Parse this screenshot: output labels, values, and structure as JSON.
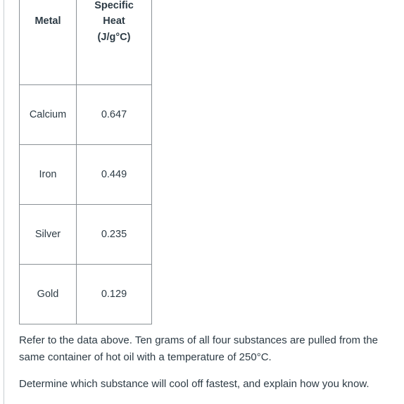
{
  "table": {
    "headers": [
      {
        "id": "metal",
        "lines": [
          "Metal"
        ]
      },
      {
        "id": "specific_heat",
        "lines": [
          "Specific",
          "Heat",
          "(J/g°C)"
        ]
      }
    ],
    "rows": [
      {
        "metal": "Calcium",
        "specific_heat": "0.647"
      },
      {
        "metal": "Iron",
        "specific_heat": "0.449"
      },
      {
        "metal": "Silver",
        "specific_heat": "0.235"
      },
      {
        "metal": "Gold",
        "specific_heat": "0.129"
      }
    ]
  },
  "body": {
    "paragraph_1": "Refer to the data above. Ten grams of all four substances are pulled from the same container of hot oil with a temperature of 250°C.",
    "paragraph_2": "Determine which substance will cool off fastest, and explain how you know."
  },
  "colors": {
    "text": "#2d3b45",
    "table_border": "#8b9196",
    "page_rule": "#c7cdd1",
    "background": "#ffffff"
  }
}
